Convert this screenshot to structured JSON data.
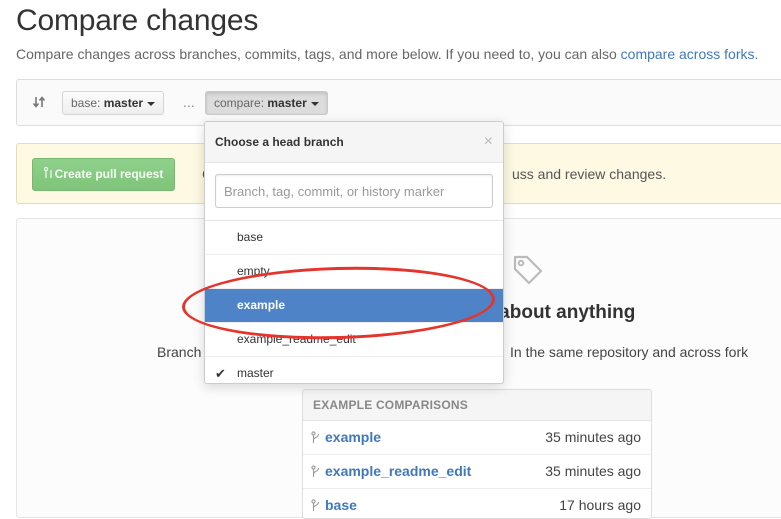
{
  "header": {
    "title": "Compare changes",
    "subtitle": "Compare changes across branches, commits, tags, and more below. If you need to, you can also",
    "subtitle_link": "compare across forks."
  },
  "range": {
    "base_prefix": "base:",
    "base_branch": "master",
    "separator": "...",
    "compare_prefix": "compare:",
    "compare_branch": "master"
  },
  "flash": {
    "button_label": "Create pull request",
    "partial_prefix": "C",
    "message_suffix": "uss and review changes."
  },
  "blankslate": {
    "title_suffix": "st about anything",
    "desc_prefix": "Branch",
    "desc_suffix": "In the same repository and across fork"
  },
  "dropdown": {
    "title": "Choose a head branch",
    "close": "×",
    "filter_placeholder": "Branch, tag, commit, or history marker",
    "items": [
      {
        "label": "base",
        "selected": false,
        "checked": false
      },
      {
        "label": "empty",
        "selected": false,
        "checked": false
      },
      {
        "label": "example",
        "selected": true,
        "checked": false
      },
      {
        "label": "example_readme_edit",
        "selected": false,
        "checked": false
      },
      {
        "label": "master",
        "selected": false,
        "checked": true
      }
    ]
  },
  "examples": {
    "header": "EXAMPLE COMPARISONS",
    "rows": [
      {
        "name": "example",
        "time": "35 minutes ago"
      },
      {
        "name": "example_readme_edit",
        "time": "35 minutes ago"
      },
      {
        "name": "base",
        "time": "17 hours ago"
      }
    ]
  },
  "colors": {
    "link": "#4078c0",
    "selected": "#4f83c8",
    "annotation": "#e4342b",
    "pr_button": "#86cb82"
  }
}
